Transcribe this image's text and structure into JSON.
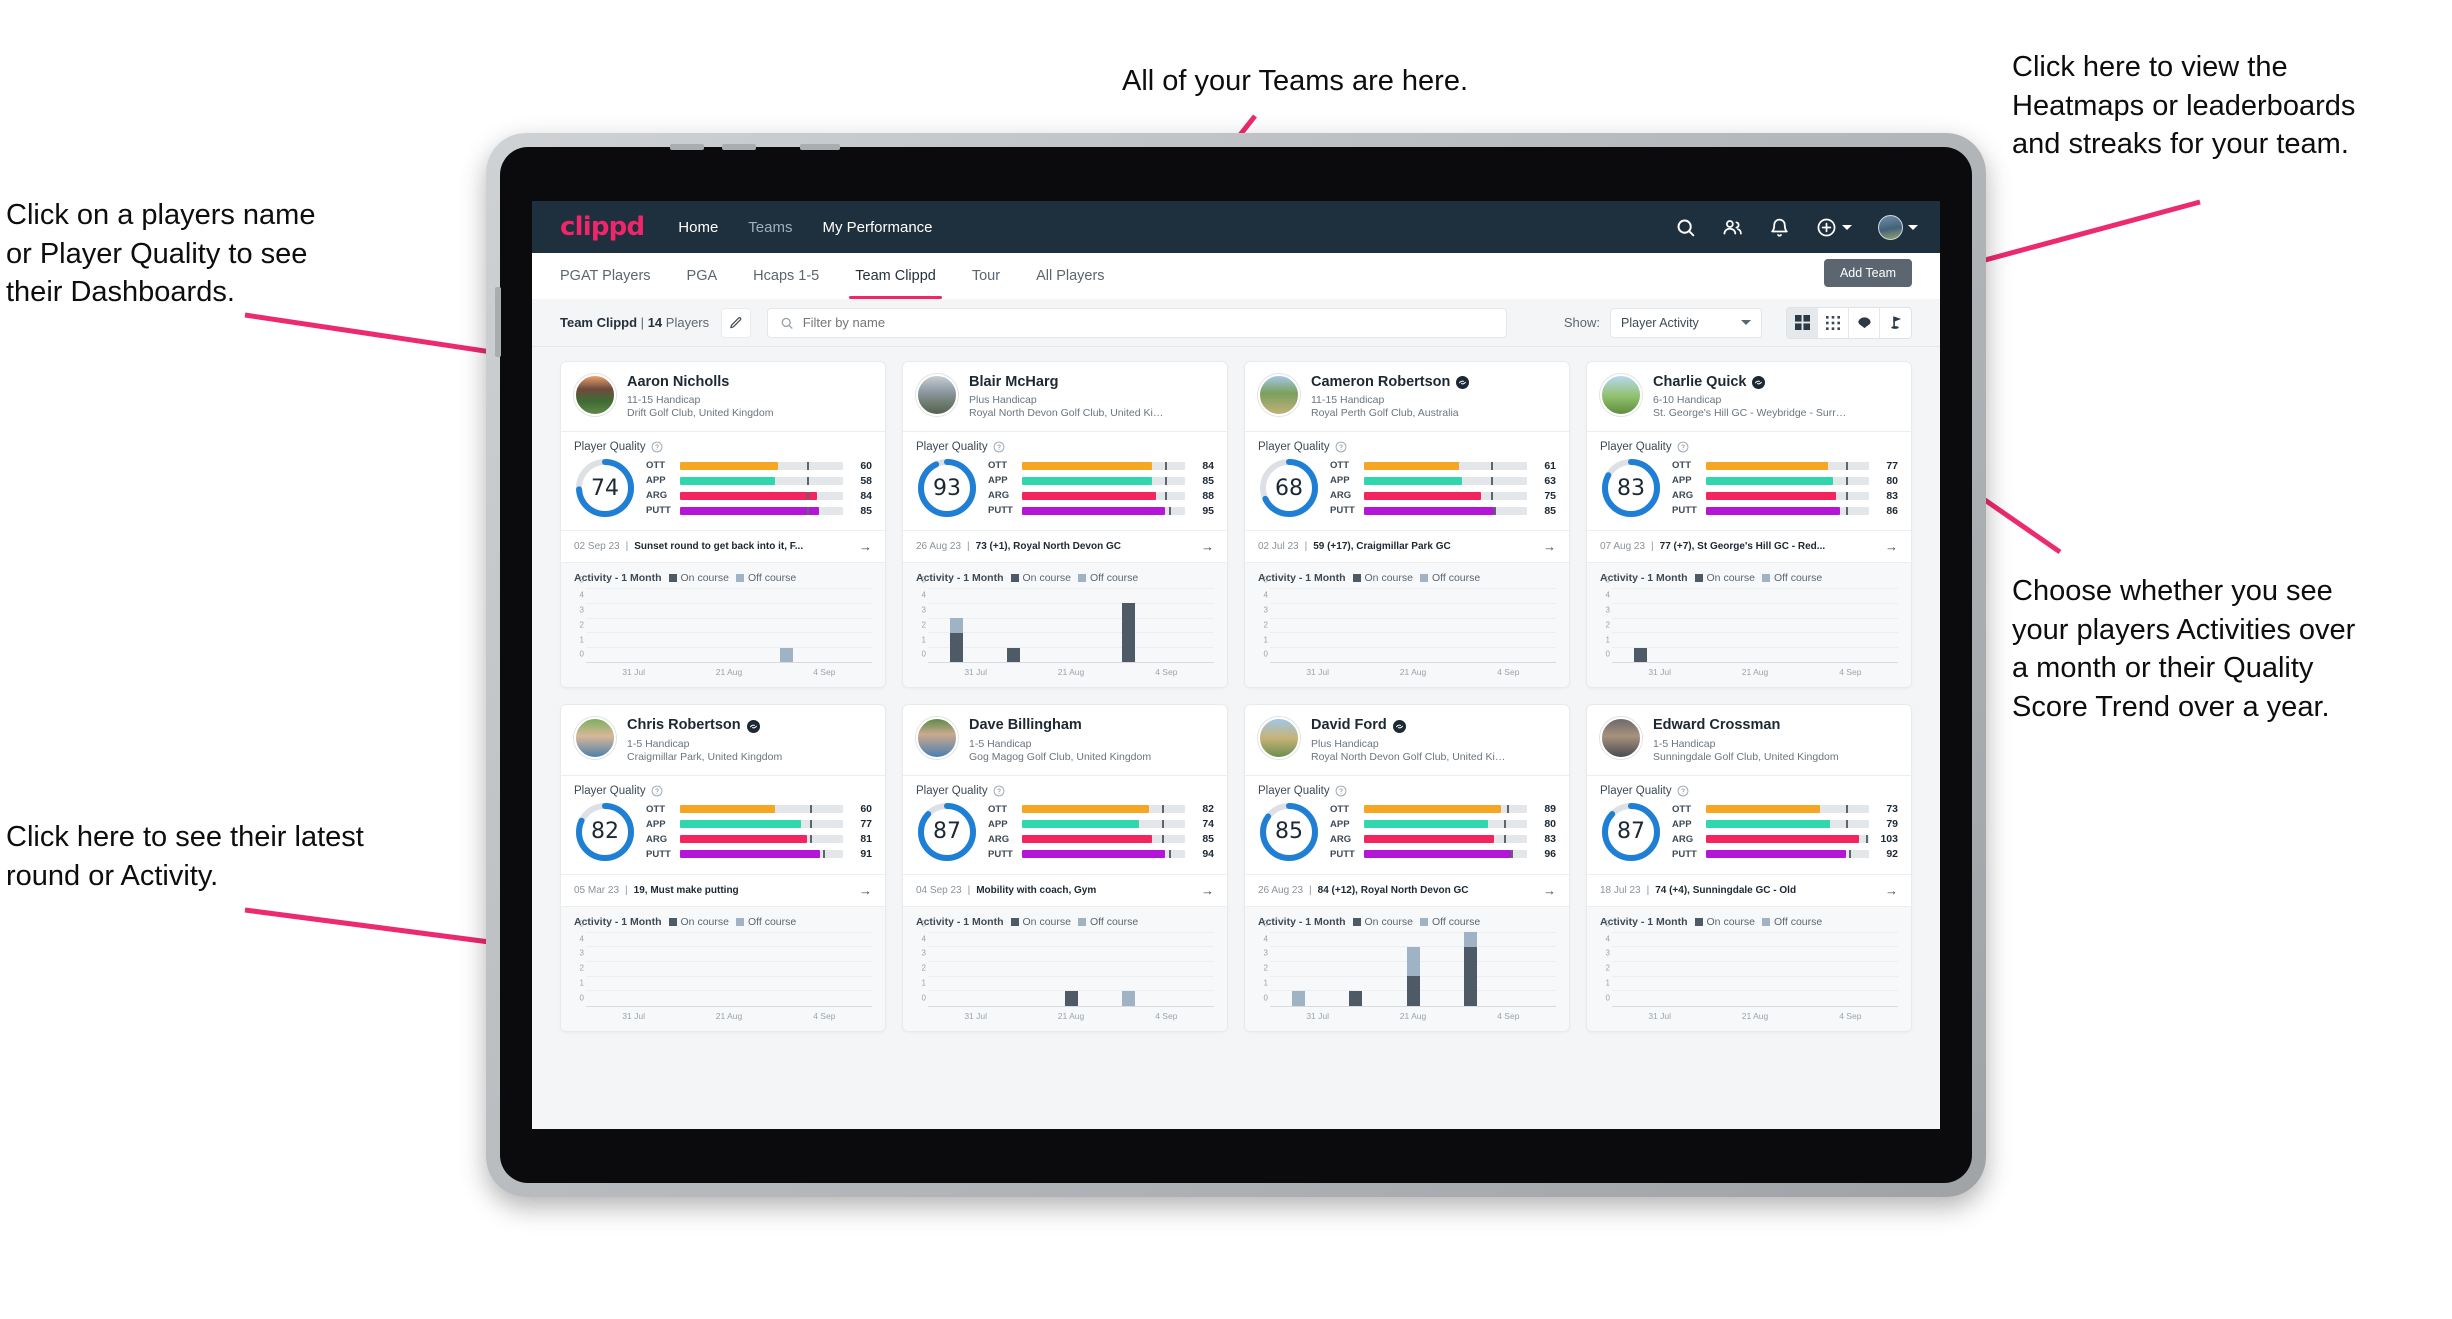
{
  "annotations": [
    {
      "id": "teams",
      "text": "All of your Teams are here."
    },
    {
      "id": "heatmaps",
      "text": "Click here to view the\nHeatmaps or leaderboards\nand streaks for your team."
    },
    {
      "id": "player-name",
      "text": "Click on a players name\nor Player Quality to see\ntheir Dashboards."
    },
    {
      "id": "activity-toggle",
      "text": "Choose whether you see\nyour players Activities over\na month or their Quality\nScore Trend over a year."
    },
    {
      "id": "latest-round",
      "text": "Click here to see their latest\nround or Activity."
    }
  ],
  "app": {
    "brand": "clippd",
    "nav": [
      {
        "label": "Home",
        "active": true
      },
      {
        "label": "Teams",
        "active": false
      },
      {
        "label": "My Performance",
        "active": true
      }
    ],
    "nav_icons": [
      "search-icon",
      "people-icon",
      "bell-icon",
      "plus-circle-icon",
      "avatar"
    ],
    "tabs": [
      {
        "label": "PGAT Players",
        "active": false
      },
      {
        "label": "PGA",
        "active": false
      },
      {
        "label": "Hcaps 1-5",
        "active": false
      },
      {
        "label": "Team Clippd",
        "active": true
      },
      {
        "label": "Tour",
        "active": false
      },
      {
        "label": "All Players",
        "active": false
      }
    ],
    "add_team_label": "Add Team",
    "filter": {
      "team_name": "Team Clippd",
      "separator": "|",
      "player_count": "14",
      "players_word": "Players",
      "edit_icon": "pencil-icon",
      "search_placeholder": "Filter by name",
      "search_value": "",
      "show_label": "Show:",
      "show_value": "Player Activity",
      "view_modes": [
        {
          "name": "grid-large-view",
          "active": true
        },
        {
          "name": "grid-dense-view",
          "active": false
        },
        {
          "name": "heatmap-view",
          "active": false
        },
        {
          "name": "golf-pin-view",
          "active": false
        }
      ]
    },
    "card_labels": {
      "player_quality": "Player Quality",
      "activity": "Activity - 1 Month",
      "on_course": "On course",
      "off_course": "Off course"
    },
    "colors": {
      "brand_pink": "#f0256a",
      "nav_dark": "#1e2f3d",
      "ring_blue": "#1f7fd4",
      "ott": "#f5a623",
      "app": "#2fd6ae",
      "arg": "#f4245e",
      "putt": "#b416d8",
      "on_course": "#4e5b66",
      "off_course": "#9fb3c5"
    }
  },
  "chart_data": {
    "type": "bar",
    "title": "Activity - 1 Month",
    "ylabel": "",
    "xlabel": "",
    "ylim": [
      0,
      5
    ],
    "yticks": [
      0,
      1,
      2,
      3,
      4,
      5
    ],
    "xticks": [
      "31 Jul",
      "21 Aug",
      "4 Sep"
    ],
    "legend": [
      "On course",
      "Off course"
    ],
    "legend_position": "top",
    "grid": true,
    "stacked": true,
    "per_player": [
      {
        "player": "Aaron Nicholls",
        "bars": [
          [
            0,
            0
          ],
          [
            0,
            0
          ],
          [
            0,
            0
          ],
          [
            0,
            1
          ],
          [
            0,
            0
          ]
        ]
      },
      {
        "player": "Blair McHarg",
        "bars": [
          [
            2,
            1
          ],
          [
            1,
            0
          ],
          [
            0,
            0
          ],
          [
            4,
            0
          ],
          [
            0,
            0
          ]
        ]
      },
      {
        "player": "Cameron Robertson",
        "bars": [
          [
            0,
            0
          ],
          [
            0,
            0
          ],
          [
            0,
            0
          ],
          [
            0,
            0
          ],
          [
            0,
            0
          ]
        ]
      },
      {
        "player": "Charlie Quick",
        "bars": [
          [
            1,
            0
          ],
          [
            0,
            0
          ],
          [
            0,
            0
          ],
          [
            0,
            0
          ],
          [
            0,
            0
          ]
        ]
      },
      {
        "player": "Chris Robertson",
        "bars": [
          [
            0,
            0
          ],
          [
            0,
            0
          ],
          [
            0,
            0
          ],
          [
            0,
            0
          ],
          [
            0,
            0
          ]
        ]
      },
      {
        "player": "Dave Billingham",
        "bars": [
          [
            0,
            0
          ],
          [
            0,
            0
          ],
          [
            1,
            0
          ],
          [
            0,
            1
          ],
          [
            0,
            0
          ]
        ]
      },
      {
        "player": "David Ford",
        "bars": [
          [
            0,
            1
          ],
          [
            1,
            0
          ],
          [
            2,
            2
          ],
          [
            4,
            1
          ],
          [
            0,
            0
          ]
        ]
      },
      {
        "player": "Edward Crossman",
        "bars": [
          [
            0,
            0
          ],
          [
            0,
            0
          ],
          [
            0,
            0
          ],
          [
            0,
            0
          ],
          [
            0,
            0
          ]
        ]
      }
    ]
  },
  "players": [
    {
      "name": "Aaron Nicholls",
      "verified": false,
      "handicap": "11-15 Handicap",
      "club": "Drift Golf Club, United Kingdom",
      "quality": 74,
      "ring_pct": 74,
      "metrics": [
        {
          "label": "OTT",
          "value": 60,
          "fill": 60,
          "tick": 78
        },
        {
          "label": "APP",
          "value": 58,
          "fill": 58,
          "tick": 78
        },
        {
          "label": "ARG",
          "value": 84,
          "fill": 84,
          "tick": 78
        },
        {
          "label": "PUTT",
          "value": 85,
          "fill": 85,
          "tick": 78
        }
      ],
      "latest_date": "02 Sep 23",
      "latest_text": "Sunset round to get back into it, F...",
      "bars": [
        [
          0,
          0
        ],
        [
          0,
          0
        ],
        [
          0,
          0
        ],
        [
          0,
          1
        ],
        [
          0,
          0
        ]
      ]
    },
    {
      "name": "Blair McHarg",
      "verified": false,
      "handicap": "Plus Handicap",
      "club": "Royal North Devon Golf Club, United Kin...",
      "quality": 93,
      "ring_pct": 93,
      "metrics": [
        {
          "label": "OTT",
          "value": 84,
          "fill": 80,
          "tick": 88
        },
        {
          "label": "APP",
          "value": 85,
          "fill": 80,
          "tick": 88
        },
        {
          "label": "ARG",
          "value": 88,
          "fill": 82,
          "tick": 88
        },
        {
          "label": "PUTT",
          "value": 95,
          "fill": 88,
          "tick": 90
        }
      ],
      "latest_date": "26 Aug 23",
      "latest_text": "73 (+1), Royal North Devon GC",
      "bars": [
        [
          2,
          1
        ],
        [
          1,
          0
        ],
        [
          0,
          0
        ],
        [
          4,
          0
        ],
        [
          0,
          0
        ]
      ]
    },
    {
      "name": "Cameron Robertson",
      "verified": true,
      "handicap": "11-15 Handicap",
      "club": "Royal Perth Golf Club, Australia",
      "quality": 68,
      "ring_pct": 68,
      "metrics": [
        {
          "label": "OTT",
          "value": 61,
          "fill": 58,
          "tick": 78
        },
        {
          "label": "APP",
          "value": 63,
          "fill": 60,
          "tick": 78
        },
        {
          "label": "ARG",
          "value": 75,
          "fill": 72,
          "tick": 78
        },
        {
          "label": "PUTT",
          "value": 85,
          "fill": 80,
          "tick": 80
        }
      ],
      "latest_date": "02 Jul 23",
      "latest_text": "59 (+17), Craigmillar Park GC",
      "bars": [
        [
          0,
          0
        ],
        [
          0,
          0
        ],
        [
          0,
          0
        ],
        [
          0,
          0
        ],
        [
          0,
          0
        ]
      ]
    },
    {
      "name": "Charlie Quick",
      "verified": true,
      "handicap": "6-10 Handicap",
      "club": "St. George's Hill GC - Weybridge - Surrey, ...",
      "quality": 83,
      "ring_pct": 83,
      "metrics": [
        {
          "label": "OTT",
          "value": 77,
          "fill": 75,
          "tick": 86
        },
        {
          "label": "APP",
          "value": 80,
          "fill": 78,
          "tick": 86
        },
        {
          "label": "ARG",
          "value": 83,
          "fill": 80,
          "tick": 86
        },
        {
          "label": "PUTT",
          "value": 86,
          "fill": 82,
          "tick": 86
        }
      ],
      "latest_date": "07 Aug 23",
      "latest_text": "77 (+7), St George's Hill GC - Red...",
      "bars": [
        [
          1,
          0
        ],
        [
          0,
          0
        ],
        [
          0,
          0
        ],
        [
          0,
          0
        ],
        [
          0,
          0
        ]
      ]
    },
    {
      "name": "Chris Robertson",
      "verified": true,
      "handicap": "1-5 Handicap",
      "club": "Craigmillar Park, United Kingdom",
      "quality": 82,
      "ring_pct": 82,
      "metrics": [
        {
          "label": "OTT",
          "value": 60,
          "fill": 58,
          "tick": 80
        },
        {
          "label": "APP",
          "value": 77,
          "fill": 74,
          "tick": 80
        },
        {
          "label": "ARG",
          "value": 81,
          "fill": 78,
          "tick": 80
        },
        {
          "label": "PUTT",
          "value": 91,
          "fill": 86,
          "tick": 88
        }
      ],
      "latest_date": "05 Mar 23",
      "latest_text": "19, Must make putting",
      "bars": [
        [
          0,
          0
        ],
        [
          0,
          0
        ],
        [
          0,
          0
        ],
        [
          0,
          0
        ],
        [
          0,
          0
        ]
      ]
    },
    {
      "name": "Dave Billingham",
      "verified": false,
      "handicap": "1-5 Handicap",
      "club": "Gog Magog Golf Club, United Kingdom",
      "quality": 87,
      "ring_pct": 87,
      "metrics": [
        {
          "label": "OTT",
          "value": 82,
          "fill": 78,
          "tick": 86
        },
        {
          "label": "APP",
          "value": 74,
          "fill": 72,
          "tick": 86
        },
        {
          "label": "ARG",
          "value": 85,
          "fill": 80,
          "tick": 86
        },
        {
          "label": "PUTT",
          "value": 94,
          "fill": 88,
          "tick": 90
        }
      ],
      "latest_date": "04 Sep 23",
      "latest_text": "Mobility with coach, Gym",
      "bars": [
        [
          0,
          0
        ],
        [
          0,
          0
        ],
        [
          1,
          0
        ],
        [
          0,
          1
        ],
        [
          0,
          0
        ]
      ]
    },
    {
      "name": "David Ford",
      "verified": true,
      "handicap": "Plus Handicap",
      "club": "Royal North Devon Golf Club, United Kin...",
      "quality": 85,
      "ring_pct": 85,
      "metrics": [
        {
          "label": "OTT",
          "value": 89,
          "fill": 84,
          "tick": 88
        },
        {
          "label": "APP",
          "value": 80,
          "fill": 76,
          "tick": 86
        },
        {
          "label": "ARG",
          "value": 83,
          "fill": 80,
          "tick": 86
        },
        {
          "label": "PUTT",
          "value": 96,
          "fill": 90,
          "tick": 90
        }
      ],
      "latest_date": "26 Aug 23",
      "latest_text": "84 (+12), Royal North Devon GC",
      "bars": [
        [
          0,
          1
        ],
        [
          1,
          0
        ],
        [
          2,
          2
        ],
        [
          4,
          1
        ],
        [
          0,
          0
        ]
      ]
    },
    {
      "name": "Edward Crossman",
      "verified": false,
      "handicap": "1-5 Handicap",
      "club": "Sunningdale Golf Club, United Kingdom",
      "quality": 87,
      "ring_pct": 87,
      "metrics": [
        {
          "label": "OTT",
          "value": 73,
          "fill": 70,
          "tick": 86
        },
        {
          "label": "APP",
          "value": 79,
          "fill": 76,
          "tick": 86
        },
        {
          "label": "ARG",
          "value": 103,
          "fill": 94,
          "tick": 98
        },
        {
          "label": "PUTT",
          "value": 92,
          "fill": 86,
          "tick": 88
        }
      ],
      "latest_date": "18 Jul 23",
      "latest_text": "74 (+4), Sunningdale GC - Old",
      "bars": [
        [
          0,
          0
        ],
        [
          0,
          0
        ],
        [
          0,
          0
        ],
        [
          0,
          0
        ],
        [
          0,
          0
        ]
      ]
    }
  ]
}
